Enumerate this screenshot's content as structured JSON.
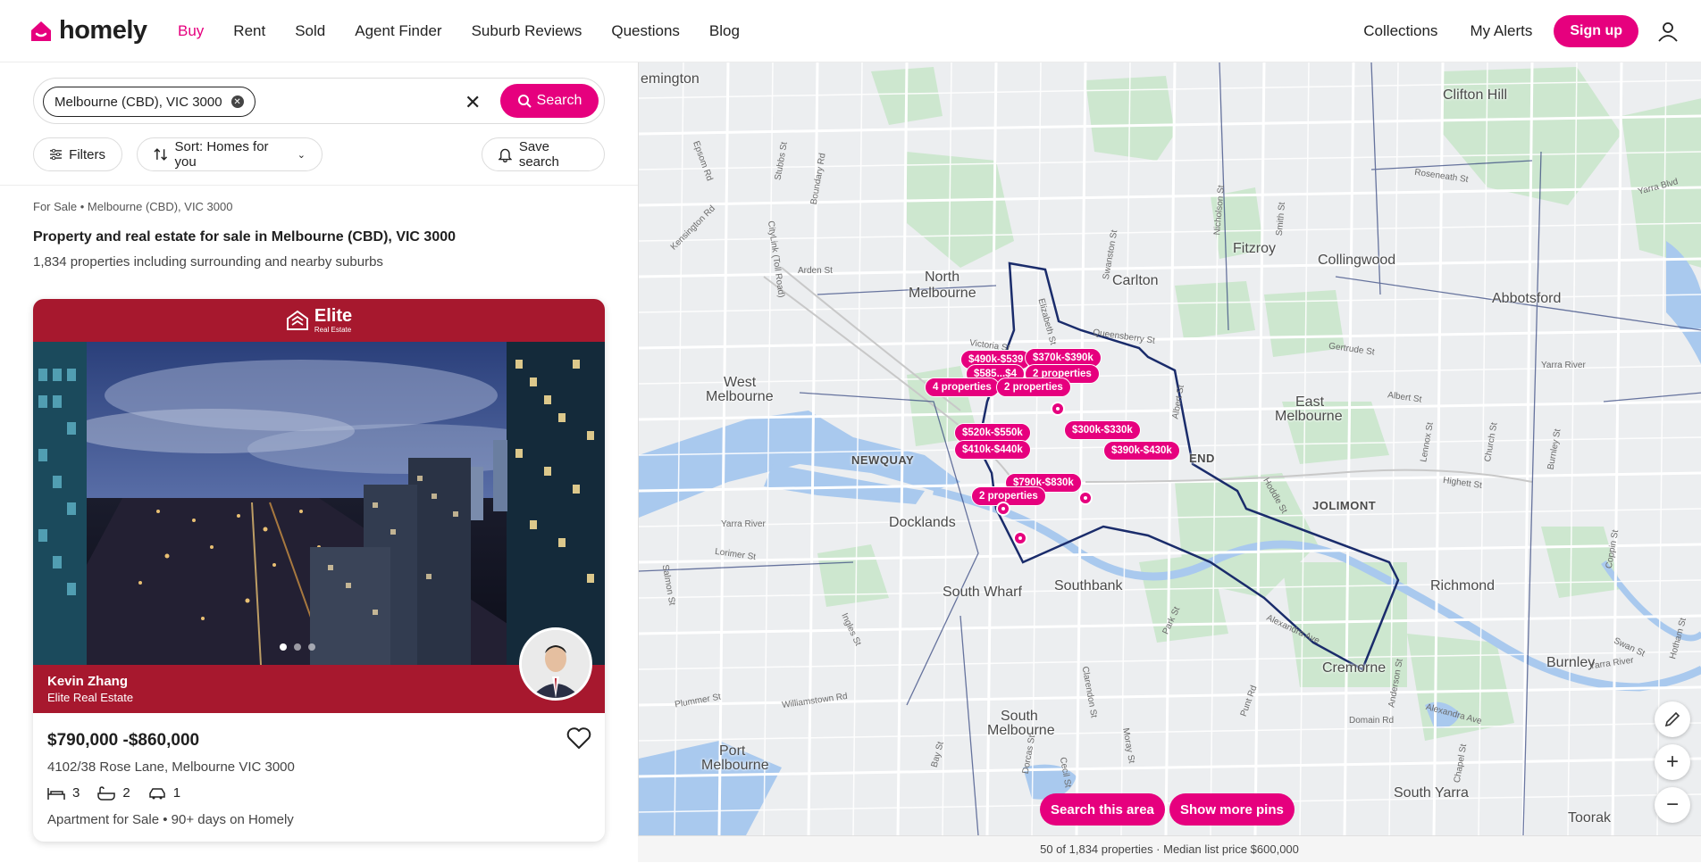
{
  "header": {
    "logo_text": "homely",
    "nav": [
      "Buy",
      "Rent",
      "Sold",
      "Agent Finder",
      "Suburb Reviews",
      "Questions",
      "Blog"
    ],
    "active_nav": "Buy",
    "right": {
      "collections": "Collections",
      "alerts": "My Alerts",
      "signup": "Sign up"
    }
  },
  "search": {
    "chip_label": "Melbourne (CBD), VIC 3000",
    "button": "Search",
    "filters": "Filters",
    "sort": "Sort: Homes for you",
    "save": "Save search"
  },
  "results": {
    "breadcrumb": "For Sale • Melbourne (CBD), VIC 3000",
    "heading": "Property and real estate for sale in Melbourne (CBD), VIC 3000",
    "count": "1,834 properties including surrounding and nearby suburbs"
  },
  "listing": {
    "agency_logo": "Elite",
    "agency_logo_sub": "Real Estate",
    "agent_name": "Kevin Zhang",
    "agent_agency": "Elite Real Estate",
    "price": "$790,000 -$860,000",
    "address": "4102/38 Rose Lane, Melbourne VIC 3000",
    "beds": "3",
    "baths": "2",
    "cars": "1",
    "type_line": "Apartment for Sale  •  90+ days on Homely"
  },
  "map": {
    "search_area": "Search this area",
    "more_pins": "Show more pins",
    "footer": "50 of 1,834 properties · Median list price $600,000",
    "places": {
      "p1": "emington",
      "p2": "Clifton Hill",
      "p3": "Fitzroy",
      "p4": "Collingwood",
      "p5": "Carlton",
      "p6": "North",
      "p7": "Melbourne",
      "p8": "Abbotsford",
      "p9": "West",
      "p10": "Melbourne",
      "p11": "East",
      "p12": "Melbourne",
      "p13": "NEWQUAY",
      "p14": "Docklands",
      "p15": "JOLIMONT",
      "p16": "END",
      "p17": "Southbank",
      "p18": "South Wharf",
      "p19": "Richmond",
      "p20": "Cremorne",
      "p21": "South",
      "p22": "Melbourne",
      "p23": "Port",
      "p24": "Melbourne",
      "p25": "South Yarra",
      "p26": "Burnley",
      "p27": "Toorak"
    },
    "streets": {
      "s1": "Epsom Rd",
      "s2": "Stubbs St",
      "s3": "Boundary Rd",
      "s4": "Kensington Rd",
      "s5": "Arden St",
      "s6": "CityLink (Toll Road)",
      "s7": "Victoria St",
      "s8": "Queensberry St",
      "s9": "Elizabeth St",
      "s10": "Swanston St",
      "s11": "Nicholson St",
      "s12": "Smith St",
      "s13": "Roseneath St",
      "s14": "Yarra Blvd",
      "s15": "Gertrude St",
      "s16": "Yarra River",
      "s17": "Albert St",
      "s18": "Highett St",
      "s19": "Lennox St",
      "s20": "Church St",
      "s21": "Burnley St",
      "s22": "Yarra River",
      "s23": "Lorimer St",
      "s24": "Salmon St",
      "s25": "Ingles St",
      "s26": "Plummer St",
      "s27": "Williamstown Rd",
      "s28": "Clarendon St",
      "s29": "Domain Rd",
      "s30": "Alexandra Ave",
      "s31": "Alexandra Ave",
      "s32": "Punt Rd",
      "s33": "Chapel St",
      "s34": "Anderson St",
      "s35": "Moray St",
      "s36": "Cecil St",
      "s37": "Bay St",
      "s38": "Dorcas St",
      "s39": "Hoddle St",
      "s40": "Coppin St",
      "s41": "Park St",
      "s42": "Swan St",
      "s43": "Yarra River",
      "s44": "Hotham St",
      "s45": "Albert St"
    },
    "pins": {
      "pn1": "$490k-$539",
      "pn2": "$370k-$390k",
      "pn3": "$585...$4",
      "pn4": "2 properties",
      "pn5": "4 properties",
      "pn6": "2 properties",
      "pn7": "$300k-$330k",
      "pn8": "$520k-$550k",
      "pn9": "$390k-$430k",
      "pn10": "$410k-$440k",
      "pn11": "$790k-$830k",
      "pn12": "2 properties"
    }
  },
  "colors": {
    "brand": "#e6007e",
    "agency": "#a7182e"
  }
}
